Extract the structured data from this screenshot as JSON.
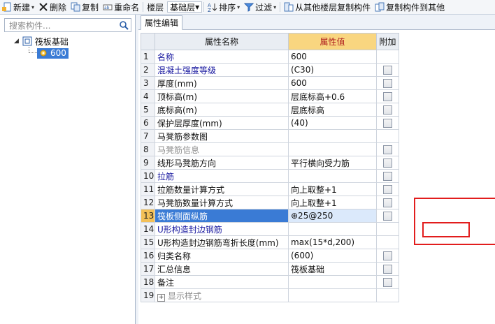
{
  "toolbar": {
    "new_label": "新建",
    "delete_label": "删除",
    "copy_label": "复制",
    "rename_label": "重命名",
    "layer_label": "楼层",
    "layer_value": "基础层",
    "sort_label": "排序",
    "filter_label": "过滤",
    "copy_from_label": "从其他楼层复制构件",
    "copy_to_label": "复制构件到其他"
  },
  "search": {
    "placeholder": "搜索构件..."
  },
  "tree": {
    "root_label": "筏板基础",
    "child_label": "600"
  },
  "tab": {
    "label": "属性编辑"
  },
  "columns": {
    "name": "属性名称",
    "value": "属性值",
    "extra": "附加"
  },
  "rows": [
    {
      "num": "1",
      "name": "名称",
      "value": "600"
    },
    {
      "num": "2",
      "name": "混凝土强度等级",
      "value": "(C30)"
    },
    {
      "num": "3",
      "name": "厚度(mm)",
      "value": "600"
    },
    {
      "num": "4",
      "name": "顶标高(m)",
      "value": "层底标高+0.6"
    },
    {
      "num": "5",
      "name": "底标高(m)",
      "value": "层底标高"
    },
    {
      "num": "6",
      "name": "保护层厚度(mm)",
      "value": "(40)"
    },
    {
      "num": "7",
      "name": "马凳筋参数图",
      "value": ""
    },
    {
      "num": "8",
      "name": "马凳筋信息",
      "value": ""
    },
    {
      "num": "9",
      "name": "线形马凳筋方向",
      "value": "平行横向受力筋"
    },
    {
      "num": "10",
      "name": "拉筋",
      "value": ""
    },
    {
      "num": "11",
      "name": "拉筋数量计算方式",
      "value": "向上取整+1"
    },
    {
      "num": "12",
      "name": "马凳筋数量计算方式",
      "value": "向上取整+1"
    },
    {
      "num": "13",
      "name": "筏板侧面纵筋",
      "value": "⊕25@250"
    },
    {
      "num": "14",
      "name": "U形构造封边钢筋",
      "value": ""
    },
    {
      "num": "15",
      "name": "U形构造封边钢筋弯折长度(mm)",
      "value": "max(15*d,200)"
    },
    {
      "num": "16",
      "name": "归类名称",
      "value": "(600)"
    },
    {
      "num": "17",
      "name": "汇总信息",
      "value": "筏板基础"
    },
    {
      "num": "18",
      "name": "备注",
      "value": ""
    },
    {
      "num": "19",
      "name": "显示样式",
      "value": ""
    }
  ],
  "colors": {
    "selection": "#3a7bd5",
    "header_value": "#f9d680",
    "annotation": "#e21d1d"
  }
}
